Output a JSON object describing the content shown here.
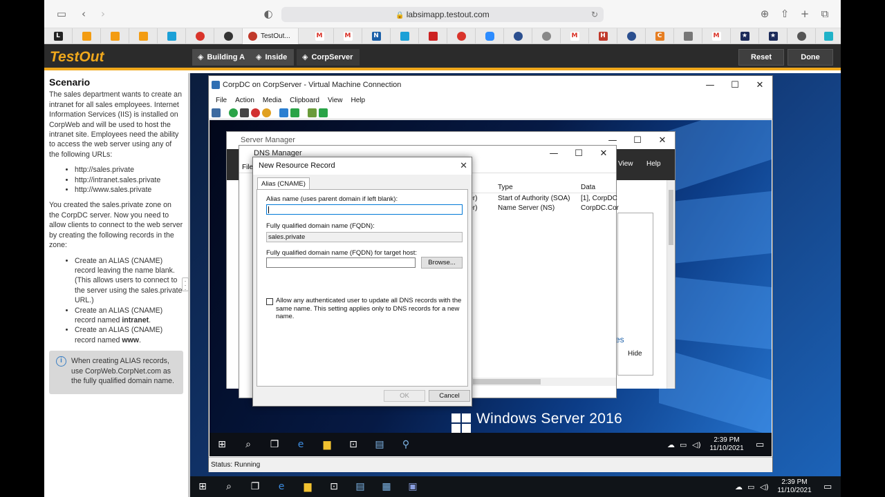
{
  "browser": {
    "url": "labsimapp.testout.com",
    "active_tab_title": "TestOut...",
    "tabs": [
      "L",
      "O",
      "O",
      "O",
      "cisco",
      "O",
      "G",
      "M",
      "M",
      "N",
      "cisco",
      "cisco",
      "O",
      "Z",
      "S",
      "P",
      "M",
      "H",
      "S",
      "C",
      "P",
      "M",
      "S",
      "S",
      "C",
      "E"
    ]
  },
  "testout": {
    "logo": "TestOut",
    "breadcrumbs": [
      "Building A",
      "Inside",
      "CorpServer"
    ],
    "reset_label": "Reset",
    "done_label": "Done"
  },
  "scenario": {
    "heading": "Scenario",
    "intro": "The sales department wants to create an intranet for all sales employees. Internet Information Services (IIS) is installed on CorpWeb and will be used to host the intranet site. Employees need the ability to access the web server using any of the following URLs:",
    "urls": [
      "http://sales.private",
      "http://intranet.sales.private",
      "http://www.sales.private"
    ],
    "middle": "You created the sales.private zone on the CorpDC server. Now you need to allow clients to connect to the web server by creating the following records in the zone:",
    "tasks": [
      {
        "text": "Create an ALIAS (CNAME) record leaving the name blank. (This allows users to connect to the server using the sales.private URL.)",
        "bold": ""
      },
      {
        "text": "Create an ALIAS (CNAME) record named ",
        "bold": "intranet"
      },
      {
        "text": "Create an ALIAS (CNAME) record named ",
        "bold": "www"
      }
    ],
    "hint": "When creating ALIAS records, use CorpWeb.CorpNet.com as the fully qualified domain name."
  },
  "vm_window": {
    "title": "CorpDC on CorpServer - Virtual Machine Connection",
    "menu": [
      "File",
      "Action",
      "Media",
      "Clipboard",
      "View",
      "Help"
    ],
    "status": "Status: Running"
  },
  "server_manager": {
    "title": "Server Manager",
    "menu_view": "View",
    "menu_help": "Help",
    "side_link": "ces",
    "hide_label": "Hide"
  },
  "dns_manager": {
    "title": "DNS Manager",
    "menu_file": "File",
    "columns": [
      "Type",
      "Data"
    ],
    "rows": [
      {
        "name_tail": "ler)",
        "type": "Start of Authority (SOA)",
        "data": "[1], CorpDC"
      },
      {
        "name_tail": "ler)",
        "type": "Name Server (NS)",
        "data": "CorpDC.Cor"
      }
    ]
  },
  "dialog": {
    "title": "New Resource Record",
    "tab": "Alias (CNAME)",
    "alias_label": "Alias name (uses parent domain if left blank):",
    "alias_value": "",
    "fqdn_label": "Fully qualified domain name (FQDN):",
    "fqdn_value": "sales.private",
    "target_label": "Fully qualified domain name (FQDN) for target host:",
    "target_value": "",
    "browse_label": "Browse...",
    "checkbox_label": "Allow any authenticated user to update all DNS records with the same name. This setting applies only to DNS records for a new name.",
    "ok_label": "OK",
    "cancel_label": "Cancel"
  },
  "vm_desktop": {
    "os_label": "Windows Server 2016",
    "time": "2:39 PM",
    "date": "11/10/2021"
  },
  "host_taskbar": {
    "time": "2:39 PM",
    "date": "11/10/2021"
  }
}
